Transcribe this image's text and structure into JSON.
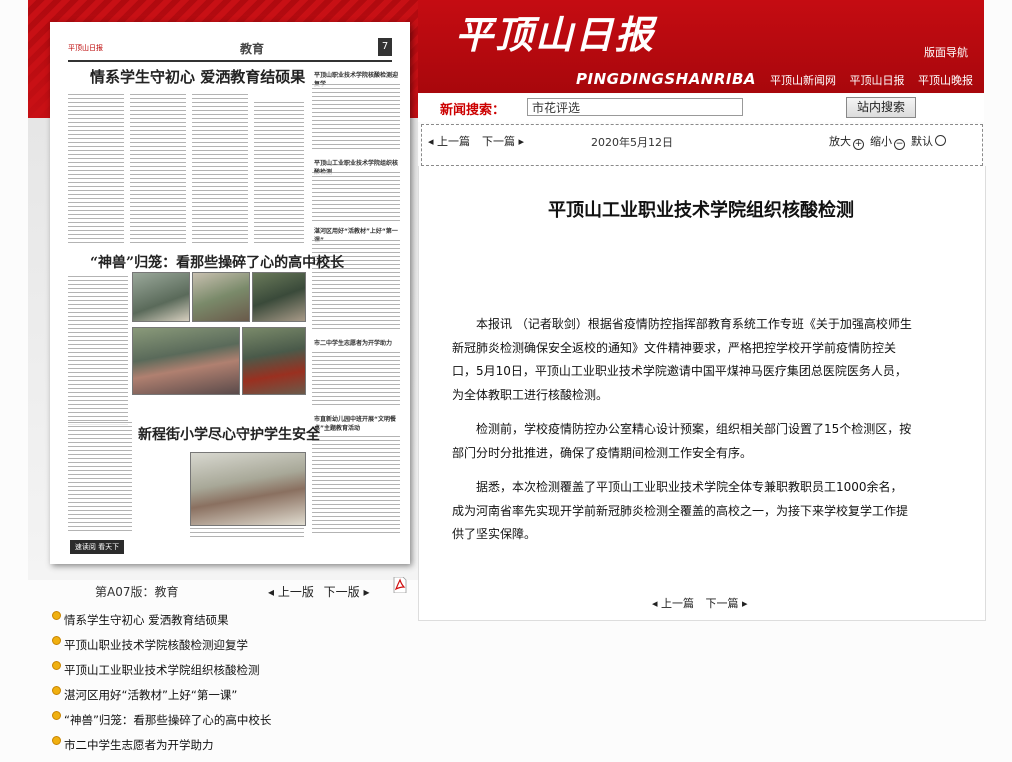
{
  "left": {
    "page_caption": "第A07版：教育",
    "pager": {
      "prev": "◂ 上一版",
      "next": "下一版 ▸"
    },
    "paper": {
      "masthead_small": "平顶山日报",
      "section": "教育",
      "page_num": "7",
      "headline1": "情系学生守初心 爱洒教育结硕果",
      "headline2": "“神兽”归笼：看那些操碎了心的高中校长",
      "headline3": "新程街小学尽心守护学生安全",
      "side1": "平顶山职业技术学院核酸检测迎复学",
      "side2": "平顶山工业职业技术学院组织核酸检测",
      "side3": "湛河区用好“活教材”上好“第一课”",
      "side4": "市二中学生志愿者为开学助力",
      "side5": "市直新幼儿园中班开展“文明餐桌”主题教育活动",
      "footer_tag": "速读阅 看天下"
    },
    "articles": [
      "情系学生守初心 爱洒教育结硕果",
      "平顶山职业技术学院核酸检测迎复学",
      "平顶山工业职业技术学院组织核酸检测",
      "湛河区用好“活教材”上好“第一课”",
      "“神兽”归笼：看那些操碎了心的高中校长",
      "市二中学生志愿者为开学助力"
    ]
  },
  "header": {
    "title": "平顶山日报",
    "pinyin": "PINGDINGSHANRIBA",
    "nav_label": "版面导航",
    "links": [
      "平顶山新闻网",
      "平顶山日报",
      "平顶山晚报"
    ]
  },
  "search": {
    "label": "新闻搜索：",
    "value": "市花评选",
    "button": "站内搜索"
  },
  "toolbar": {
    "prev": "◂ 上一篇",
    "next": "下一篇 ▸",
    "date": "2020年5月12日",
    "zoom_in": "放大",
    "zoom_out": "缩小",
    "default": "默认"
  },
  "article": {
    "title": "平顶山工业职业技术学院组织核酸检测",
    "paragraphs": [
      "本报讯 （记者耿剑）根据省疫情防控指挥部教育系统工作专班《关于加强高校师生新冠肺炎检测确保安全返校的通知》文件精神要求，严格把控学校开学前疫情防控关口，5月10日，平顶山工业职业技术学院邀请中国平煤神马医疗集团总医院医务人员，为全体教职工进行核酸检测。",
      "检测前，学校疫情防控办公室精心设计预案，组织相关部门设置了15个检测区，按部门分时分批推进，确保了疫情期间检测工作安全有序。",
      "据悉，本次检测覆盖了平顶山工业职业技术学院全体专兼职教职员工1000余名，成为河南省率先实现开学前新冠肺炎检测全覆盖的高校之一，为接下来学校复学工作提供了坚实保障。"
    ],
    "pager": {
      "prev": "◂ 上一篇",
      "next": "下一篇 ▸"
    }
  },
  "colors": {
    "brand_red": "#c50c12",
    "bullet": "#f0b010"
  }
}
